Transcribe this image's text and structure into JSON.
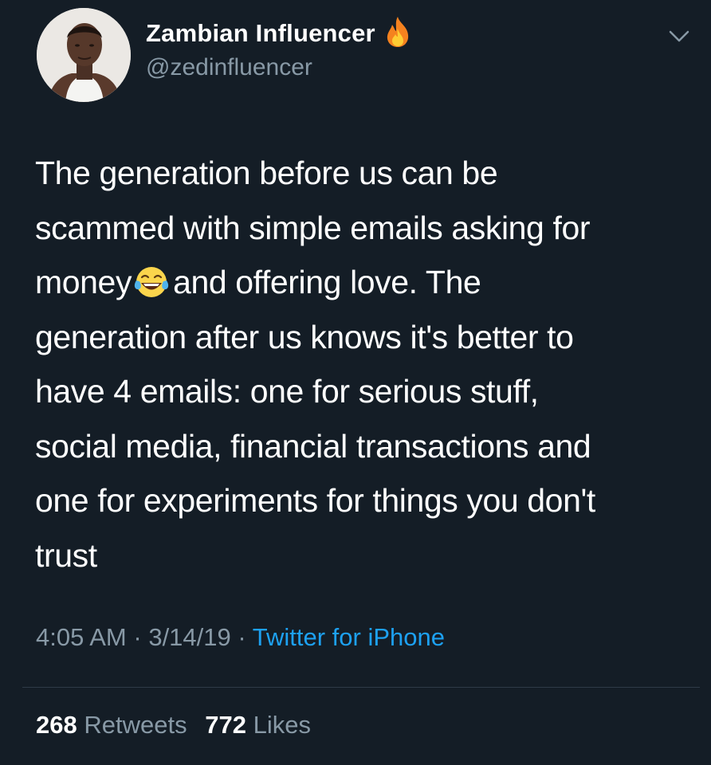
{
  "user": {
    "display_name": "Zambian Influencer",
    "handle": "@zedinfluencer",
    "name_badge_icon": "fire-icon"
  },
  "tweet": {
    "text_lines": [
      "The generation before us can be",
      "scammed with simple emails asking for",
      "money",
      "and offering love. The",
      "generation after us knows it's better to",
      "have 4 emails: one for serious stuff,",
      "social media, financial transactions and",
      "one for experiments for things you don't",
      "trust"
    ],
    "inline_emoji": "face-with-tears-of-joy-icon"
  },
  "meta": {
    "time": "4:05 AM",
    "separator": "·",
    "date": "3/14/19",
    "source": "Twitter for iPhone"
  },
  "stats": {
    "retweets_count": "268",
    "retweets_label": "Retweets",
    "likes_count": "772",
    "likes_label": "Likes"
  },
  "colors": {
    "background": "#141d26",
    "text": "#ffffff",
    "secondary_text": "#8899a6",
    "link": "#1da1f2",
    "divider": "#2f3b47"
  }
}
